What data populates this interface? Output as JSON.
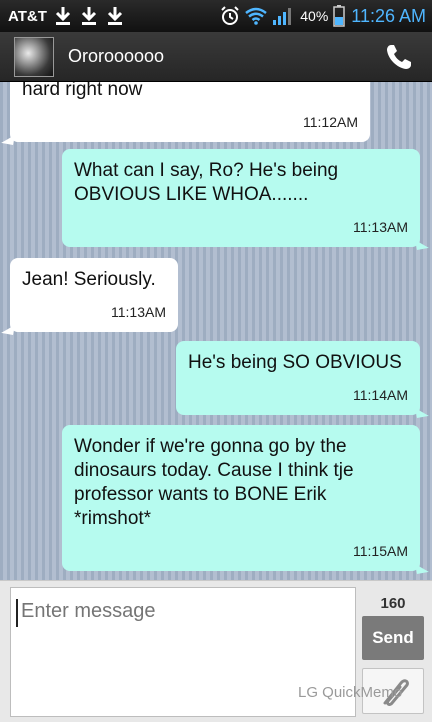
{
  "status_bar": {
    "carrier": "AT&T",
    "battery": "40%",
    "time": "11:26 AM",
    "icons": [
      "download-icon",
      "download-icon",
      "download-icon",
      "alarm-icon",
      "wifi-icon",
      "signal-icon",
      "battery-icon"
    ],
    "time_color": "#4fb6ff"
  },
  "header": {
    "contact_name": "Ororoooooo",
    "call_icon": "phone-icon"
  },
  "messages": [
    {
      "direction": "in",
      "text": "hard right now",
      "time": "11:12AM"
    },
    {
      "direction": "out",
      "text": "What can I say, Ro? He's being OBVIOUS LIKE WHOA.......",
      "time": "11:13AM"
    },
    {
      "direction": "in",
      "text": "Jean! Seriously.",
      "time": "11:13AM"
    },
    {
      "direction": "out",
      "text": "He's being SO OBVIOUS",
      "time": "11:14AM"
    },
    {
      "direction": "out",
      "text": "Wonder if we're gonna go by the dinosaurs today. Cause I think tje professor wants to BONE Erik *rimshot*",
      "time": "11:15AM"
    }
  ],
  "composer": {
    "placeholder": "Enter message",
    "char_count": "160",
    "send_label": "Send",
    "attach_icon": "paperclip-icon",
    "watermark": "LG QuickMemo"
  },
  "colors": {
    "incoming_bubble": "#ffffff",
    "outgoing_bubble": "#b6fbef",
    "send_button": "#7a7a7a"
  }
}
